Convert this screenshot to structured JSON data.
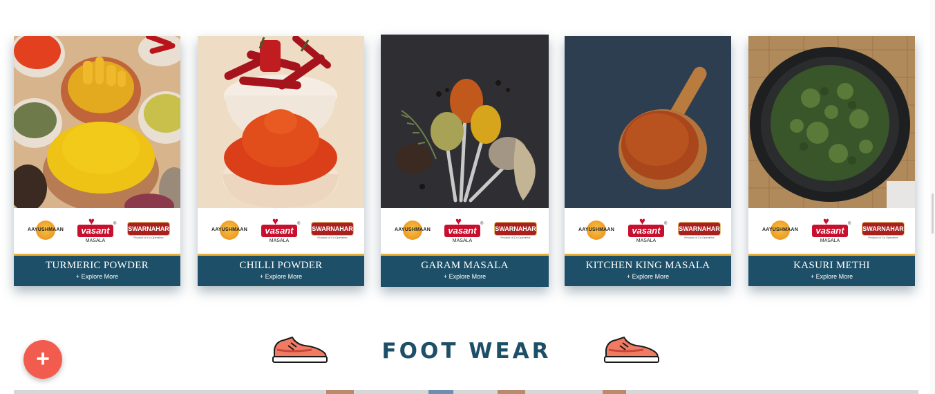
{
  "cards": [
    {
      "title": "TURMERIC POWDER",
      "explore": "+ Explore More"
    },
    {
      "title": "CHILLI POWDER",
      "explore": "+ Explore More"
    },
    {
      "title": "GARAM MASALA",
      "explore": "+ Explore More"
    },
    {
      "title": "KITCHEN KING MASALA",
      "explore": "+ Explore More"
    },
    {
      "title": "KASURI METHI",
      "explore": "+ Explore More"
    }
  ],
  "brands": {
    "aayushmaan": "AAYUSHMAAN",
    "vasant": "vasant",
    "vasant_sub": "MASALA",
    "vasant_reg": "®",
    "swarnahar": "SWARNAHAR",
    "swarnahar_tag": "Product of Co-Operative"
  },
  "section": {
    "title": "FOOT WEAR"
  },
  "fab": {
    "label": "+"
  },
  "icons": {
    "shoe": "sneaker-icon",
    "plus": "plus-icon"
  },
  "colors": {
    "band": "#1d5068",
    "accent": "#f25c4e",
    "gold": "#e8b23a",
    "brand_red": "#c8102e"
  }
}
